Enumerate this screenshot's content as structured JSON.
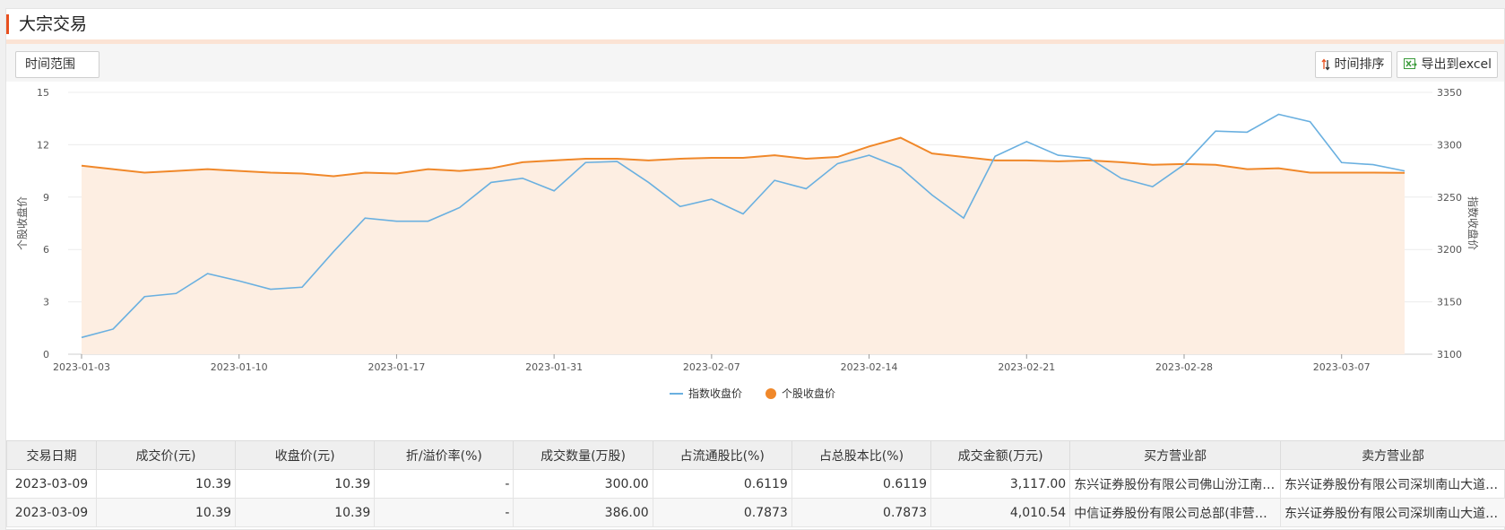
{
  "header": {
    "title": "大宗交易"
  },
  "toolbar": {
    "time_range_label": "时间范围",
    "sort_label": "时间排序",
    "export_label": "导出到excel"
  },
  "colors": {
    "index_line": "#6ab0e0",
    "stock_line": "#f0882a",
    "stock_fill": "#fdeee2",
    "accent": "#e8501f"
  },
  "chart_data": {
    "type": "line",
    "title": "",
    "x_ticks": [
      "2023-01-03",
      "2023-01-10",
      "2023-01-17",
      "2023-01-31",
      "2023-02-07",
      "2023-02-14",
      "2023-02-21",
      "2023-02-28",
      "2023-03-07"
    ],
    "x_tick_index": [
      0,
      5,
      10,
      15,
      20,
      25,
      30,
      35,
      40
    ],
    "y_left": {
      "label": "个股收盘价",
      "lim": [
        0,
        15
      ],
      "ticks": [
        0,
        3,
        6,
        9,
        12,
        15
      ]
    },
    "y_right": {
      "label": "指数收盘价",
      "lim": [
        3100,
        3350
      ],
      "ticks": [
        3100,
        3150,
        3200,
        3250,
        3300,
        3350
      ]
    },
    "grid": true,
    "legend": "bottom-center",
    "series": [
      {
        "name": "指数收盘价",
        "axis": "right",
        "values": [
          3116,
          3124,
          3155,
          3158,
          3177,
          3170,
          3162,
          3164,
          3198,
          3230,
          3227,
          3227,
          3240,
          3264,
          3268,
          3256,
          3283,
          3284,
          3264,
          3241,
          3248,
          3234,
          3266,
          3258,
          3282,
          3290,
          3278,
          3252,
          3230,
          3289,
          3303,
          3290,
          3287,
          3268,
          3260,
          3281,
          3313,
          3312,
          3329,
          3322,
          3283,
          3281,
          3275
        ]
      },
      {
        "name": "个股收盘价",
        "axis": "left",
        "values": [
          10.8,
          10.6,
          10.4,
          10.5,
          10.6,
          10.5,
          10.4,
          10.35,
          10.2,
          10.4,
          10.35,
          10.6,
          10.5,
          10.65,
          11.0,
          11.1,
          11.2,
          11.2,
          11.1,
          11.2,
          11.25,
          11.25,
          11.4,
          11.2,
          11.3,
          11.9,
          12.4,
          11.5,
          11.3,
          11.1,
          11.1,
          11.05,
          11.1,
          11.0,
          10.85,
          10.9,
          10.85,
          10.6,
          10.65,
          10.4,
          10.4,
          10.4,
          10.39
        ]
      }
    ]
  },
  "table": {
    "headers": [
      "交易日期",
      "成交价(元)",
      "收盘价(元)",
      "折/溢价率(%)",
      "成交数量(万股)",
      "占流通股比(%)",
      "占总股本比(%)",
      "成交金额(万元)",
      "买方营业部",
      "卖方营业部"
    ],
    "rows": [
      [
        "2023-03-09",
        "10.39",
        "10.39",
        "-",
        "300.00",
        "0.6119",
        "0.6119",
        "3,117.00",
        "东兴证券股份有限公司佛山汾江南路证券营业部",
        "东兴证券股份有限公司深圳南山大道证券营业部"
      ],
      [
        "2023-03-09",
        "10.39",
        "10.39",
        "-",
        "386.00",
        "0.7873",
        "0.7873",
        "4,010.54",
        "中信证券股份有限公司总部(非营业场所)",
        "东兴证券股份有限公司深圳南山大道证券营业部"
      ]
    ]
  }
}
